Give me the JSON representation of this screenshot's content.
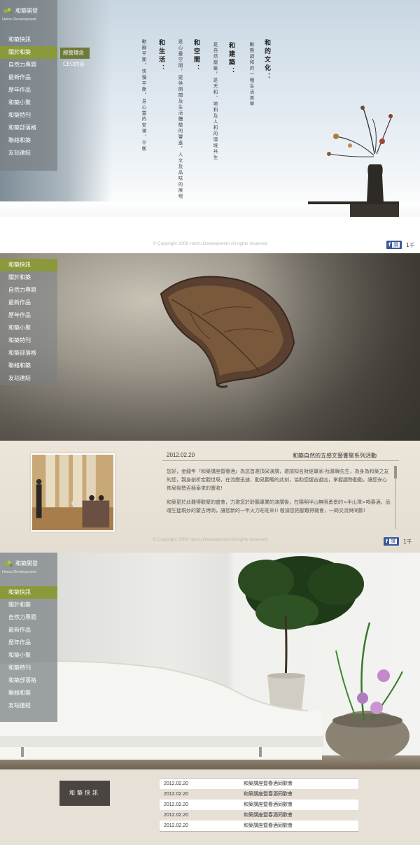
{
  "brand": {
    "name_zh": "和築開發",
    "name_en": "Herzu Development"
  },
  "nav": [
    "和築快訊",
    "關於和築",
    "自然力專題",
    "最新作品",
    "歷年作品",
    "和築小聚",
    "和築特刊",
    "和築部落格",
    "聯絡和築",
    "友站連結"
  ],
  "screen1": {
    "active_nav_index": 1,
    "subnav": [
      "經營理念",
      "CEO的話"
    ],
    "active_sub_index": 0,
    "columns": [
      {
        "head": "和的文化：",
        "body": "動態調和的一種生活美學"
      },
      {
        "head": "和建築：",
        "body": "是自然建築，是天和、地和及人和的環境共生"
      },
      {
        "head": "和空間：",
        "body": "是心靈空間，提供開闊及生活體驗的豐進，人文及品味的展現"
      },
      {
        "head": "和生活：",
        "body": "動靜平衡，快慢平衡，身心靈的安頓、平衡"
      }
    ],
    "copyright": "© Copyright  2009 Herzu Development All rights reserved",
    "fb_label": "讚",
    "fb_count": "1千"
  },
  "screen2": {
    "active_nav_index": 0,
    "date": "2012.02.20",
    "title": "和築自然的五感文藝饗聚系列活動",
    "paragraphs": [
      "您好，金龍年『和築講座暨春酒』為您首邀頂采演講，邀請知名財經專家-阮慕驊先生，為身為和築之友的您，親身剖析宏觀世局，在流變迅速、動見觀瞻的此刻，協助您趨吉避凶，掌握趨勢動動，讓您安心佈局後勢否極泰來的豐收!",
      "和築更於此難得歡聚的盛會，力邀您於聆聽專業的演講後，在陽明半山無限勇景的<半山澤>喝春酒，品嚐生猛現炒的蒙古烤肉，讓您新的一年火力旺旺來!! 敬請您把握難得機會，一同交流與同歡!"
    ],
    "copyright": "© Copyright  2009 Herzu Development All rights reserved",
    "fb_label": "讚",
    "fb_count": "1千"
  },
  "screen3": {
    "active_nav_index": 0,
    "news_button": "和築快訊",
    "news": [
      {
        "date": "2012.02.20",
        "title": "和築講座暨春酒同歡會"
      },
      {
        "date": "2012.02.20",
        "title": "和築講座暨春酒同歡會"
      },
      {
        "date": "2012.02.20",
        "title": "和築講座暨春酒同歡會"
      },
      {
        "date": "2012.02.20",
        "title": "和築講座暨春酒同歡會"
      },
      {
        "date": "2012.02.20",
        "title": "和築講座暨春酒同歡會"
      }
    ]
  },
  "colors": {
    "nav_active": "#8a9a3a",
    "nav_bg": "#7e888c",
    "page_beige": "#e9e3d8",
    "fb_blue": "#3b5998"
  },
  "icons": [
    "herzu-logo-icon",
    "facebook-like-icon",
    "scrollbar-icon"
  ]
}
